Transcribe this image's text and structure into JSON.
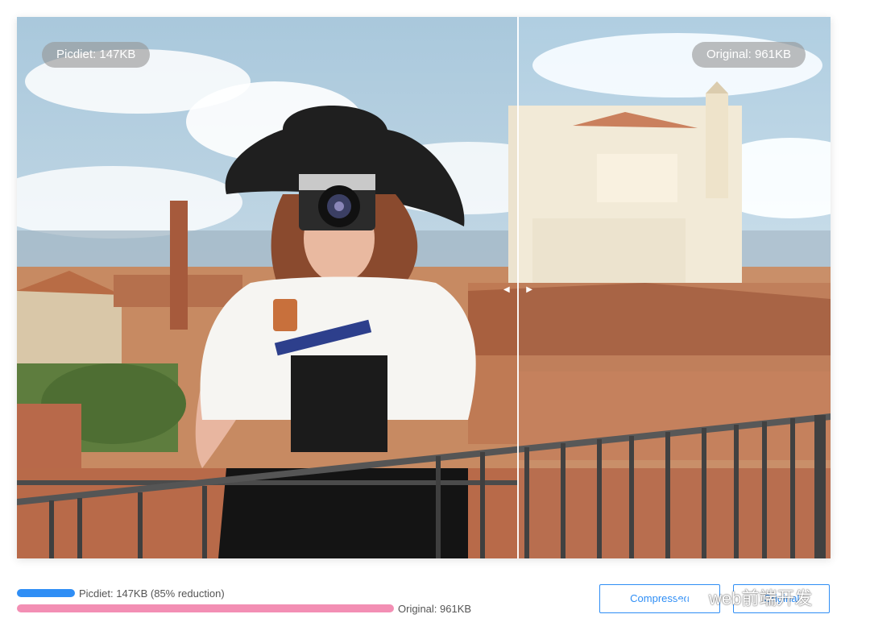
{
  "viewer": {
    "compressed_label": "Picdiet: 147KB",
    "original_label": "Original: 961KB"
  },
  "stats": {
    "compressed_text": "Picdiet: 147KB (85% reduction)",
    "original_text": "Original: 961KB",
    "compressed_ratio": 0.153,
    "colors": {
      "compressed": "#2f8ef5",
      "original": "#f38fb4"
    }
  },
  "buttons": {
    "compressed": "Compressed",
    "original": "Original"
  },
  "watermark": {
    "text": "web前端开发",
    "icon": "wechat-icon"
  }
}
